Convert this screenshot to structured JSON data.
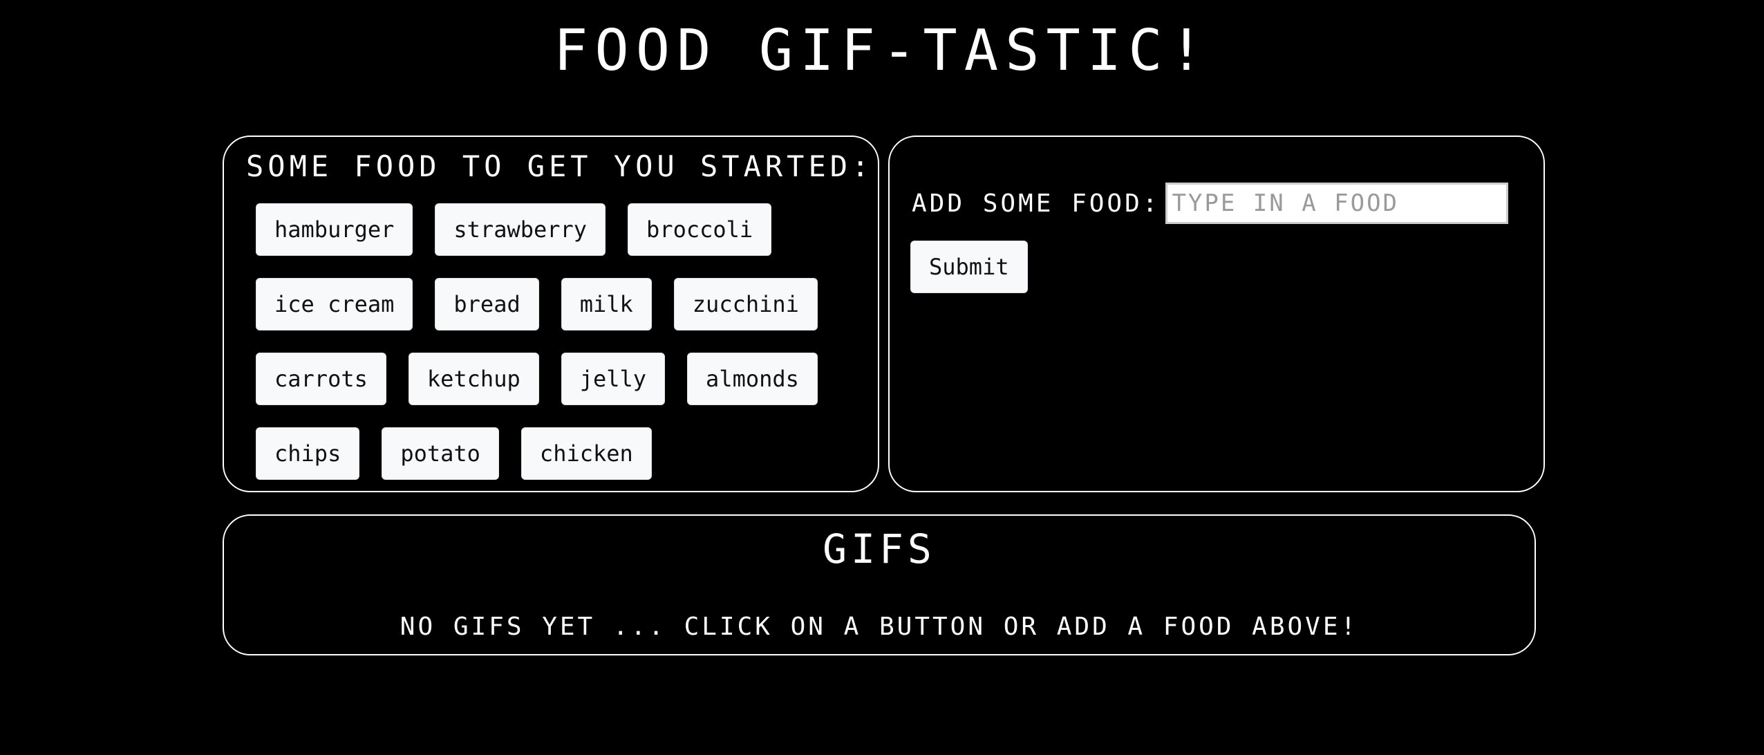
{
  "header": {
    "title": "Food GIF-tastic!"
  },
  "starter": {
    "heading": "Some food to get you started:",
    "rows": [
      [
        "hamburger",
        "strawberry",
        "broccoli"
      ],
      [
        "ice cream",
        "bread",
        "milk",
        "zucchini"
      ],
      [
        "carrots",
        "ketchup",
        "jelly",
        "almonds"
      ],
      [
        "chips",
        "potato",
        "chicken"
      ]
    ]
  },
  "add_food": {
    "label": "Add some food:",
    "placeholder": "Type in a food",
    "value": "",
    "submit_label": "Submit"
  },
  "gifs": {
    "heading": "GIFs",
    "empty_message": "No GIFs yet ... click on a button or add a food above!"
  },
  "colors": {
    "background": "#000000",
    "text": "#ffffff",
    "button_bg": "#f8f9fa",
    "button_text": "#111111"
  }
}
